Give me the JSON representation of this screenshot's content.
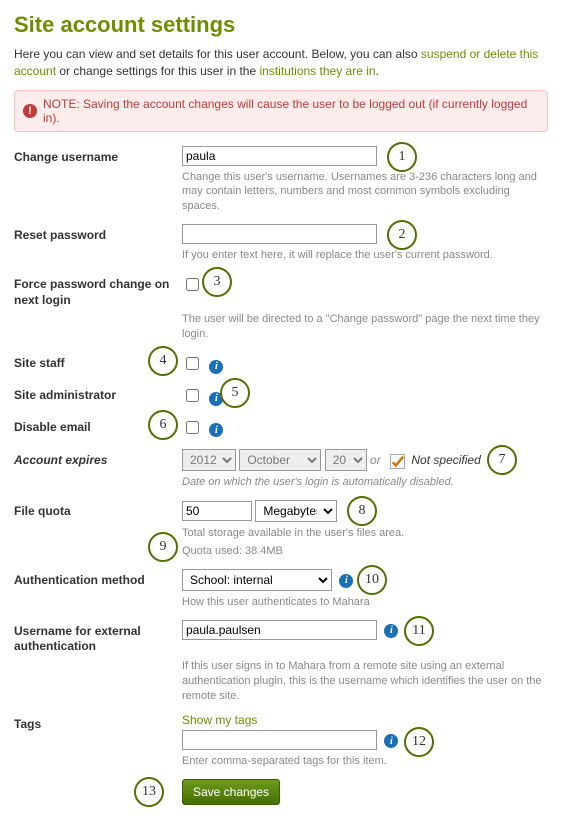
{
  "title": "Site account settings",
  "intro": {
    "text1": "Here you can view and set details for this user account. Below, you can also ",
    "link1": "suspend or delete this account",
    "text2": " or change settings for this user in the ",
    "link2": "institutions they are in",
    "text3": "."
  },
  "note": "NOTE: Saving the account changes will cause the user to be logged out (if currently logged in).",
  "fields": {
    "change_username": {
      "label": "Change username",
      "value": "paula",
      "help": "Change this user's username. Usernames are 3-236 characters long and may contain letters, numbers and most common symbols excluding spaces."
    },
    "reset_password": {
      "label": "Reset password",
      "value": "",
      "help": "If you enter text here, it will replace the user's current password."
    },
    "force_password": {
      "label": "Force password change on next login",
      "help": "The user will be directed to a \"Change password\" page the next time they login."
    },
    "site_staff": {
      "label": "Site staff"
    },
    "site_admin": {
      "label": "Site administrator"
    },
    "disable_email": {
      "label": "Disable email"
    },
    "account_expires": {
      "label": "Account expires",
      "year": "2012",
      "month": "October",
      "day": "20",
      "or": "or",
      "not_specified": "Not specified",
      "help": "Date on which the user's login is automatically disabled."
    },
    "file_quota": {
      "label": "File quota",
      "value": "50",
      "unit": "Megabytes",
      "help1": "Total storage available in the user's files area.",
      "help2": "Quota used: 38.4MB"
    },
    "auth_method": {
      "label": "Authentication method",
      "value": "School: internal",
      "help": "How this user authenticates to Mahara"
    },
    "ext_username": {
      "label": "Username for external authentication",
      "value": "paula.paulsen",
      "help": "If this user signs in to Mahara from a remote site using an external authentication plugin, this is the username which identifies the user on the remote site."
    },
    "tags": {
      "label": "Tags",
      "showtags": "Show my tags",
      "value": "",
      "help": "Enter comma-separated tags for this item."
    }
  },
  "buttons": {
    "save": "Save changes"
  },
  "annotations": [
    "1",
    "2",
    "3",
    "4",
    "5",
    "6",
    "7",
    "8",
    "9",
    "10",
    "11",
    "12",
    "13"
  ]
}
